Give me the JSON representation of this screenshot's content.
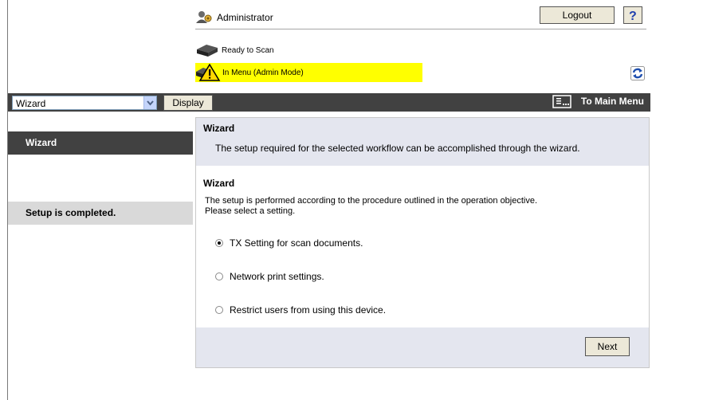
{
  "header": {
    "user_name": "Administrator",
    "logout_label": "Logout",
    "help_label": "?",
    "status_scan": "Ready to Scan",
    "status_mode": "In Menu (Admin Mode)"
  },
  "topbar": {
    "select_value": "Wizard",
    "display_label": "Display",
    "main_menu_label": "To Main Menu"
  },
  "sidebar": {
    "items": [
      {
        "label": "Wizard",
        "state": "active"
      },
      {
        "label": "Setup is completed.",
        "state": "inactive"
      }
    ]
  },
  "panel": {
    "title": "Wizard",
    "description": "The setup required for the selected workflow can be accomplished through the wizard.",
    "section_title": "Wizard",
    "section_desc_1": "The setup is performed according to the procedure outlined in the operation objective.",
    "section_desc_2": "Please select a setting.",
    "options": [
      {
        "label": "TX Setting for scan documents.",
        "selected": true
      },
      {
        "label": "Network print settings.",
        "selected": false
      },
      {
        "label": "Restrict users from using this device.",
        "selected": false
      }
    ],
    "next_label": "Next"
  },
  "colors": {
    "dark_bar": "#414141",
    "panel_bg": "#e4e6ef",
    "warning": "#ffff00",
    "button_face": "#ece8d8"
  },
  "icons": [
    "admin-user-icon",
    "help-icon",
    "scanner-icon",
    "warning-icon",
    "refresh-icon",
    "dropdown-arrow-icon",
    "main-menu-icon"
  ]
}
